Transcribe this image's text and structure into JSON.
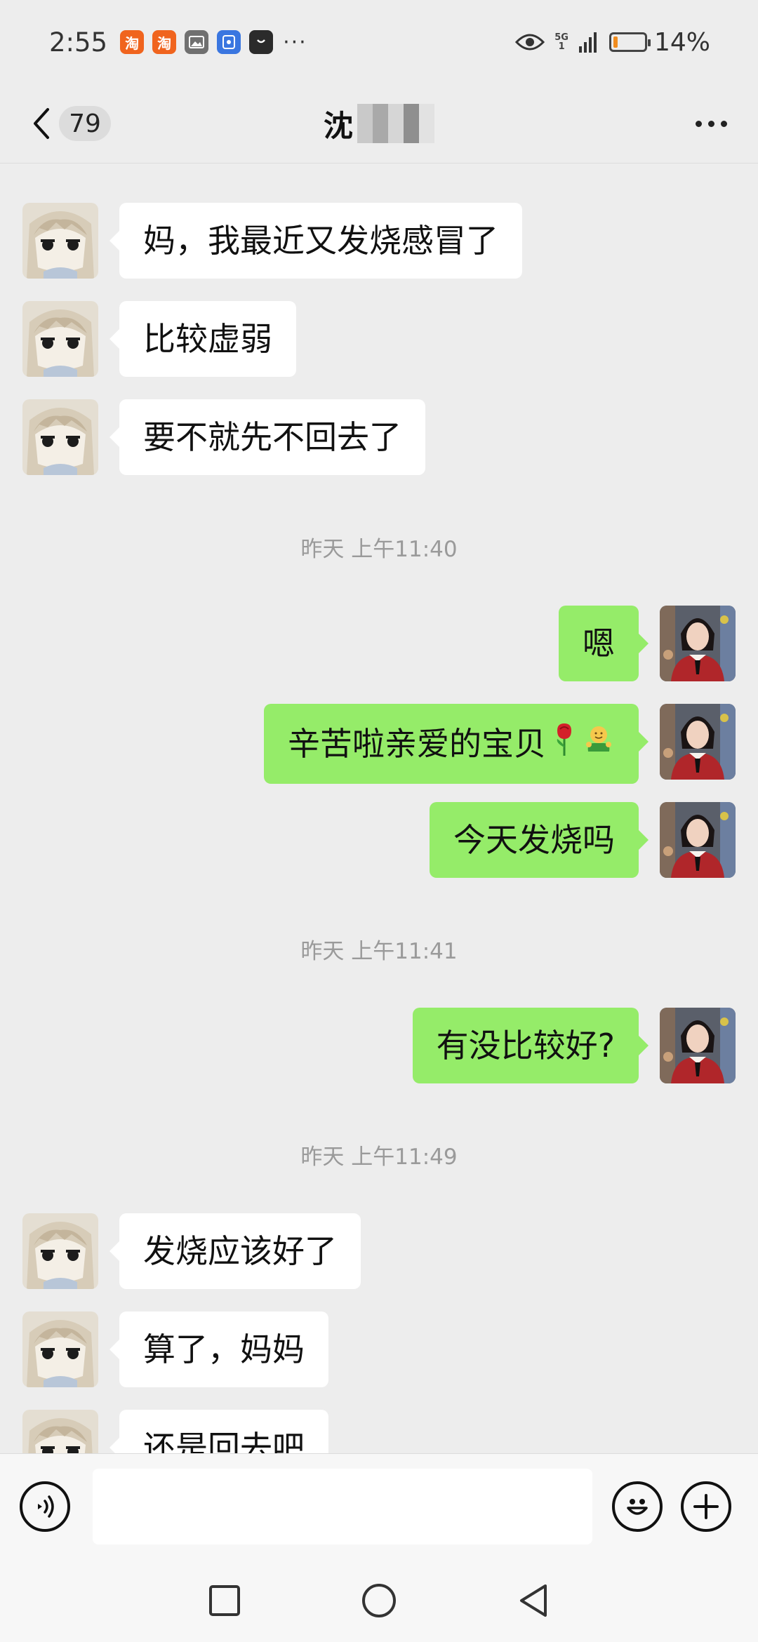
{
  "status_bar": {
    "time": "2:55",
    "app_icons": [
      {
        "name": "taobao-icon",
        "glyph": "淘",
        "color": "#f0641e"
      },
      {
        "name": "taobao-icon",
        "glyph": "淘",
        "color": "#f0641e"
      },
      {
        "name": "gallery-icon",
        "glyph": "",
        "color": "#707070"
      },
      {
        "name": "security-icon",
        "glyph": "",
        "color": "#3a76e0"
      },
      {
        "name": "shopping-bag-icon",
        "glyph": "",
        "color": "#2b2b2b"
      }
    ],
    "more": "···",
    "network_top": "5G",
    "network_bottom": "1",
    "battery_percent": "14%",
    "battery_level": 0.14
  },
  "header": {
    "unread_count": "79",
    "contact_name": "沈"
  },
  "messages": [
    {
      "side": "left",
      "text": "妈，我最近又发烧感冒了"
    },
    {
      "side": "left",
      "text": "比较虚弱"
    },
    {
      "side": "left",
      "text": "要不就先不回去了"
    },
    {
      "type": "time",
      "text": "昨天 上午11:40"
    },
    {
      "side": "right",
      "text": "嗯"
    },
    {
      "side": "right",
      "text": "辛苦啦亲爱的宝贝",
      "emoji": [
        "rose-emoji",
        "hug-emoji"
      ]
    },
    {
      "side": "right",
      "text": "今天发烧吗"
    },
    {
      "type": "time",
      "text": "昨天 上午11:41"
    },
    {
      "side": "right",
      "text": "有没比较好?"
    },
    {
      "type": "time",
      "text": "昨天 上午11:49"
    },
    {
      "side": "left",
      "text": "发烧应该好了"
    },
    {
      "side": "left",
      "text": "算了，妈妈"
    },
    {
      "side": "left",
      "text": "还是回去吧"
    }
  ],
  "input": {
    "value": "",
    "placeholder": ""
  },
  "icons": {
    "voice": "voice-icon",
    "emoji": "smiley-icon",
    "add": "plus-icon",
    "nav_recent": "square-icon",
    "nav_home": "circle-icon",
    "nav_back": "triangle-back-icon"
  },
  "colors": {
    "background": "#ededed",
    "sent_bubble": "#95ec69",
    "received_bubble": "#ffffff",
    "timestamp": "#9a9a9a"
  }
}
